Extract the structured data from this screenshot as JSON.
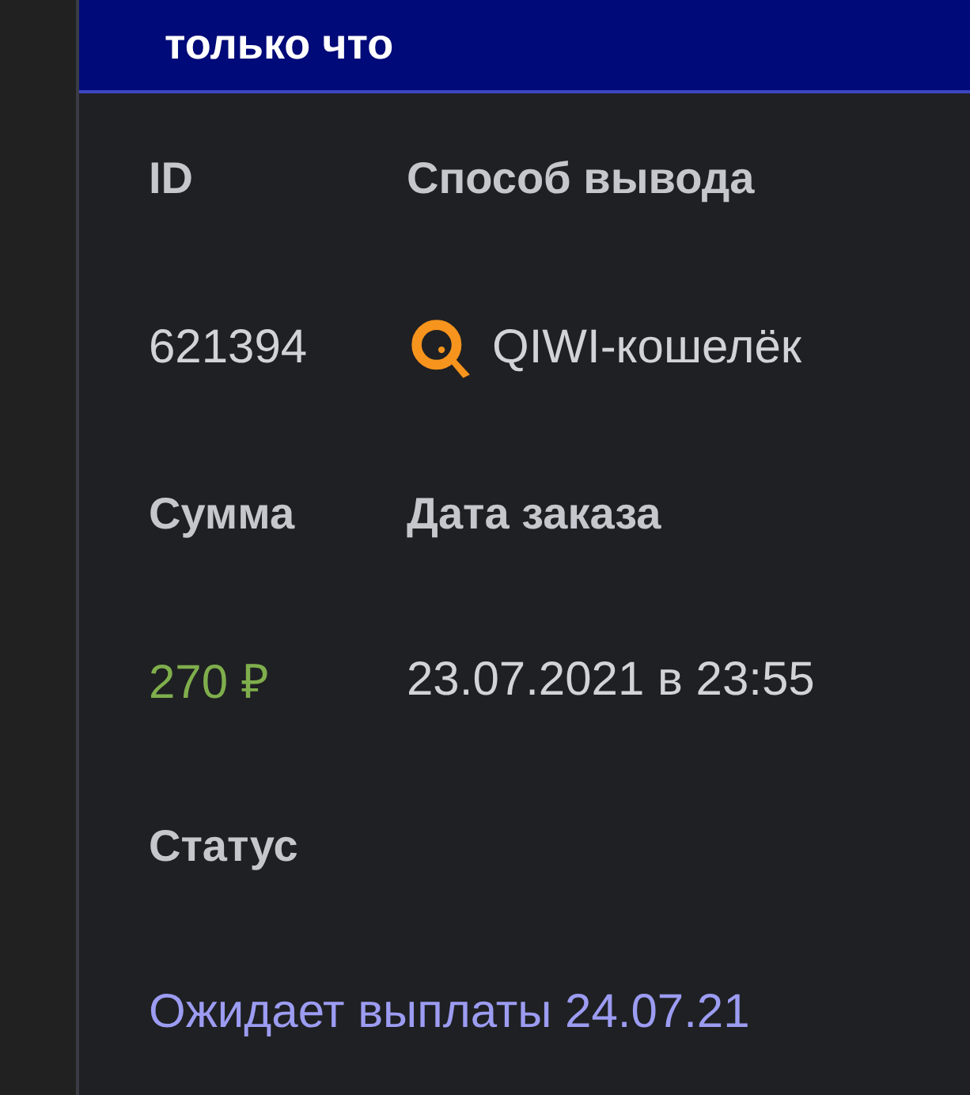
{
  "header": {
    "time": "только что"
  },
  "fields": [
    {
      "label": "ID",
      "value": "621394",
      "kind": "plain"
    },
    {
      "label": "Способ вывода",
      "value": "QIWI-кошелёк",
      "kind": "qiwi"
    },
    {
      "label": "Сумма",
      "value": "270 ₽",
      "kind": "amount"
    },
    {
      "label": "Дата заказа",
      "value": "23.07.2021 в 23:55",
      "kind": "plain"
    },
    {
      "label": "Статус",
      "value": "Ожидает выплаты 24.07.21",
      "kind": "status"
    }
  ]
}
